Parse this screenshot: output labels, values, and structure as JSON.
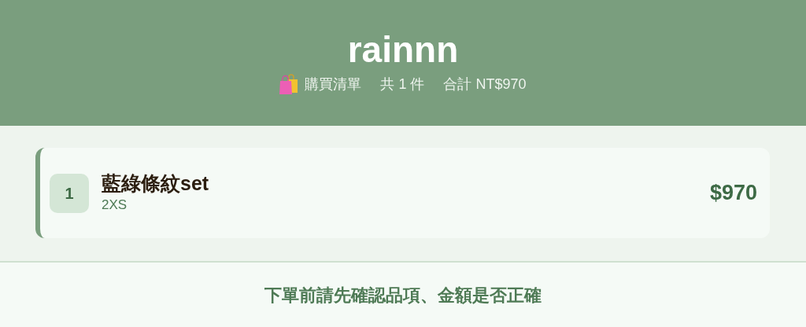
{
  "header": {
    "title": "rainnn",
    "list_label": "購買清單",
    "count": "共 1 件",
    "total": "合計 NT$970"
  },
  "items": [
    {
      "index": "1",
      "name": "藍綠條紋set",
      "size": "2XS",
      "price": "$970"
    }
  ],
  "footer": {
    "notice": "下單前請先確認品項、金額是否正確"
  }
}
